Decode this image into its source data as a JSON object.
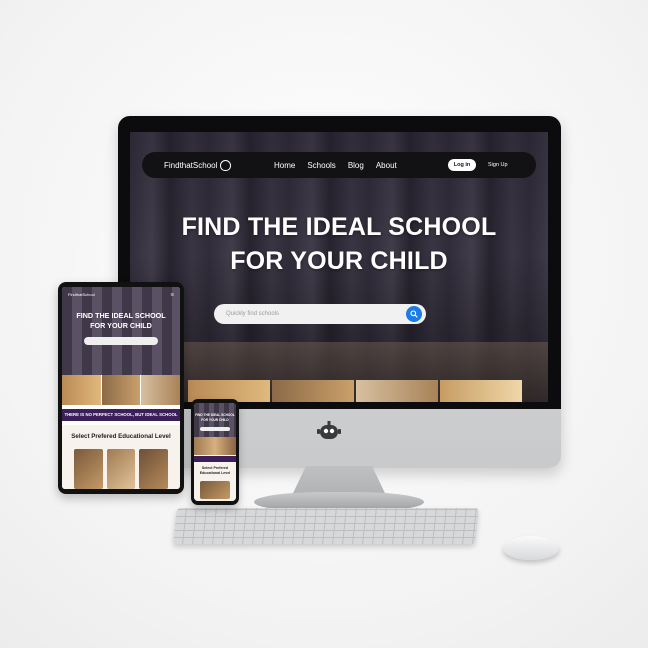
{
  "desktop": {
    "brand": "FindthatSchool",
    "nav": [
      "Home",
      "Schools",
      "Blog",
      "About"
    ],
    "login": "Log in",
    "signup": "Sign Up",
    "hero_line1": "FIND THE IDEAL SCHOOL",
    "hero_line2": "FOR YOUR CHILD",
    "search_placeholder": "Quickly find schools"
  },
  "tablet": {
    "brand": "FindthatSchool",
    "hero_line1": "FIND THE IDEAL SCHOOL",
    "hero_line2": "FOR YOUR CHILD",
    "banner": "THERE IS NO PERFECT SCHOOL, BUT IDEAL SCHOOL",
    "section_title": "Select Prefered Educational Level"
  },
  "phone": {
    "hero_line1": "FIND THE IDEAL SCHOOL",
    "hero_line2": "FOR YOUR CHILD",
    "section_line1": "Select Prefered",
    "section_line2": "Educational Level"
  },
  "colors": {
    "accent_blue": "#1b7ce6",
    "banner_purple": "#3b1f58",
    "navbar": "#121214"
  },
  "icons": [
    "owl-logo-icon",
    "search-icon",
    "robot-logo-icon"
  ]
}
